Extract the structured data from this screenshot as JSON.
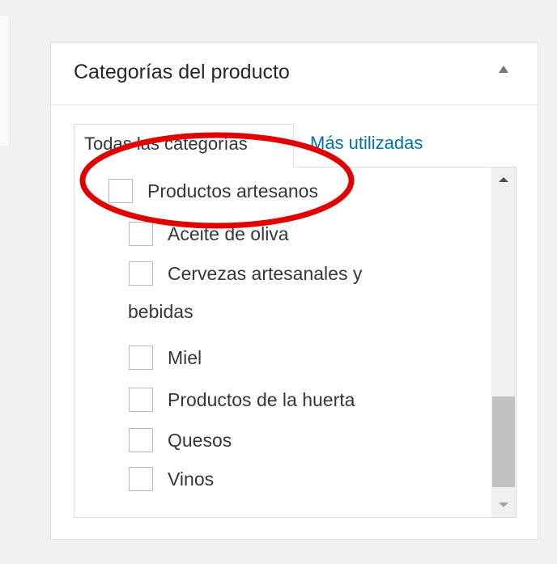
{
  "metabox": {
    "title": "Categorías del producto",
    "toggle_icon": "triangle-up-icon"
  },
  "tabs": [
    {
      "label": "Todas las categorías",
      "active": true
    },
    {
      "label": "Más utilizadas",
      "active": false
    }
  ],
  "categories": [
    {
      "label": "Productos artesanos",
      "checked": false,
      "level": 0
    },
    {
      "label": "Aceite de oliva",
      "checked": false,
      "level": 1
    },
    {
      "label": "Cervezas artesanales y",
      "label_wrap": "bebidas",
      "checked": false,
      "level": 1
    },
    {
      "label": "Miel",
      "checked": false,
      "level": 1
    },
    {
      "label": "Productos de la huerta",
      "checked": false,
      "level": 1
    },
    {
      "label": "Quesos",
      "checked": false,
      "level": 1
    },
    {
      "label": "Vinos",
      "checked": false,
      "level": 1
    }
  ],
  "annotation": {
    "shape": "ellipse",
    "color": "#e00000"
  },
  "colors": {
    "link": "#0073aa",
    "border": "#dcdcde",
    "background": "#f1f1f1"
  }
}
